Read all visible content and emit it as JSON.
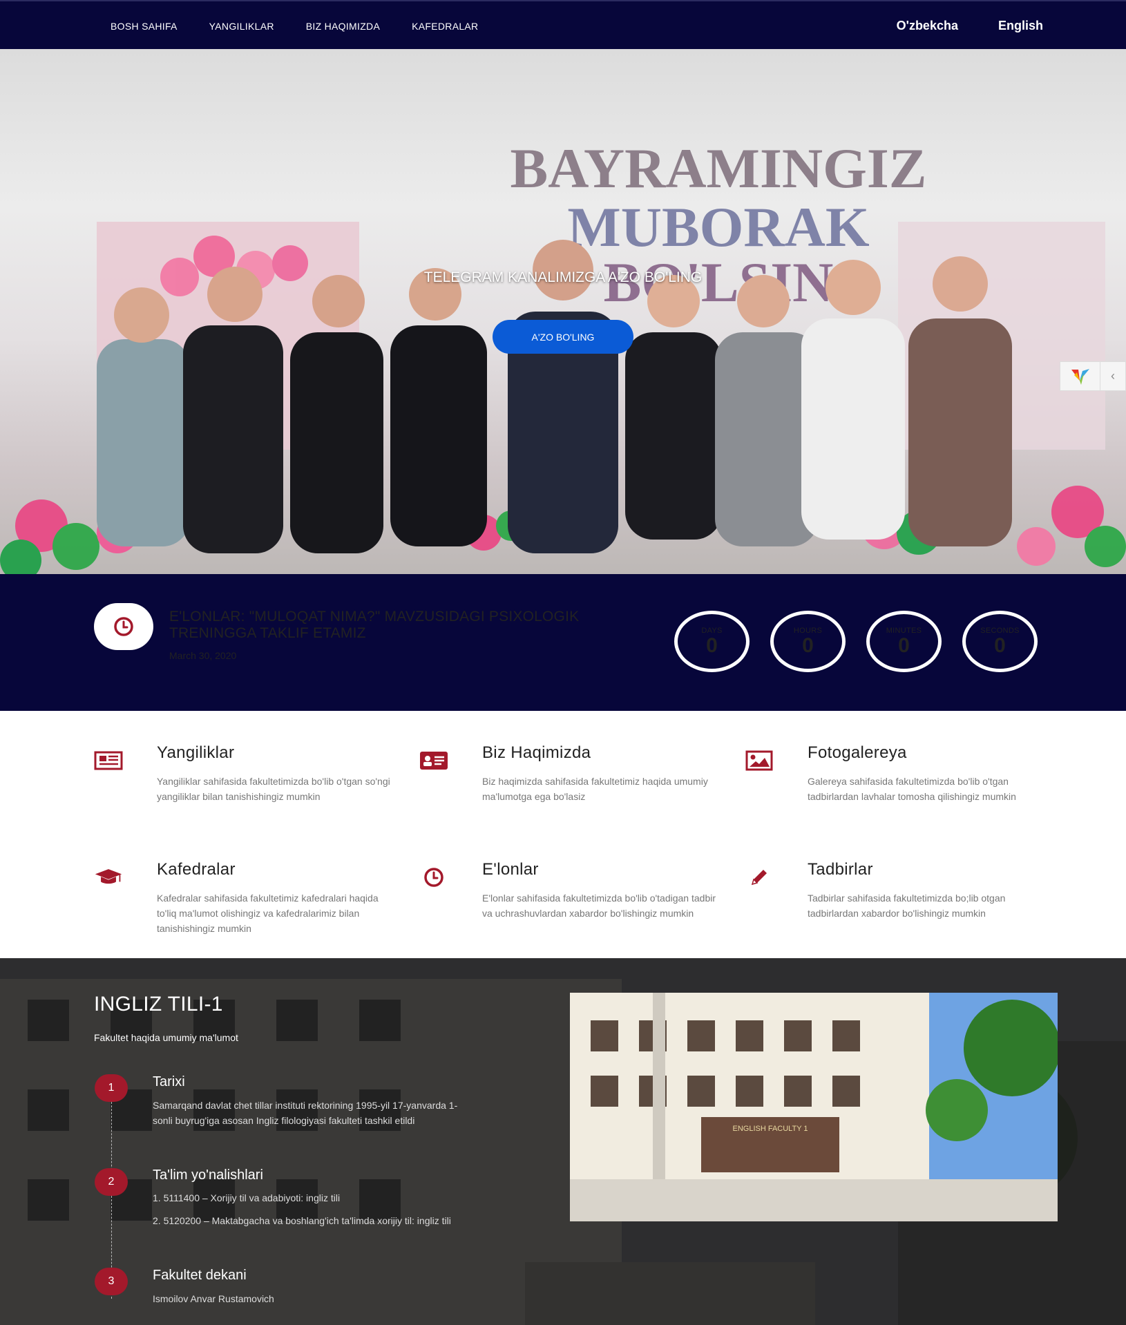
{
  "nav": {
    "links": [
      "BOSH SAHIFA",
      "YANGILIKLAR",
      "BIZ HAQIMIZDA",
      "KAFEDRALAR"
    ],
    "languages": [
      "O'zbekcha",
      "English"
    ]
  },
  "hero": {
    "banner_text_line1": "BAYRAMINGIZ",
    "banner_text_line2": "MUBORAK",
    "banner_text_line3": "BO'LSIN",
    "title": "TELEGRAM KANALIMIZGA A'ZO BO'LING",
    "button": "A'ZO BO'LING"
  },
  "announcement": {
    "title": "E'LONLAR: \"MULOQAT NIMA?\" MAVZUSIDAGI PSIXOLOGIK TRENINGGA TAKLIF ETAMIZ",
    "date": "March 30, 2020",
    "countdown": [
      {
        "label": "DAYS",
        "value": "0"
      },
      {
        "label": "HOURS",
        "value": "0"
      },
      {
        "label": "MINUTES",
        "value": "0"
      },
      {
        "label": "SECONDS",
        "value": "0"
      }
    ]
  },
  "features": [
    {
      "icon": "newspaper-icon",
      "title": "Yangiliklar",
      "desc": "Yangiliklar sahifasida fakultetimizda bo'lib o'tgan so'ngi yangiliklar bilan tanishishingiz mumkin"
    },
    {
      "icon": "id-card-icon",
      "title": "Biz Haqimizda",
      "desc": "Biz haqimizda sahifasida fakultetimiz haqida umumiy ma'lumotga ega bo'lasiz"
    },
    {
      "icon": "picture-icon",
      "title": "Fotogalereya",
      "desc": "Galereya sahifasida fakultetimizda bo'lib o'tgan tadbirlardan lavhalar tomosha qilishingiz mumkin"
    },
    {
      "icon": "graduation-cap-icon",
      "title": "Kafedralar",
      "desc": "Kafedralar sahifasida fakultetimiz kafedralari haqida to'liq ma'lumot olishingiz va kafedralarimiz bilan tanishishingiz mumkin"
    },
    {
      "icon": "clock-icon",
      "title": "E'lonlar",
      "desc": "E'lonlar sahifasida fakultetimizda bo'lib o'tadigan tadbir va uchrashuvlardan xabardor bo'lishingiz mumkin"
    },
    {
      "icon": "pencil-icon",
      "title": "Tadbirlar",
      "desc": "Tadbirlar sahifasida fakultetimizda bo;lib otgan tadbirlardan xabardor bo'lishingiz mumkin"
    }
  ],
  "about": {
    "title": "INGLIZ TILI-1",
    "subtitle": "Fakultet haqida umumiy ma'lumot",
    "timeline": [
      {
        "num": "1",
        "title": "Tarixi",
        "lines": [
          "Samarqand davlat chet tillar instituti rektorining 1995-yil 17-yanvarda 1-sonli buyrug'iga asosan Ingliz filologiyasi fakulteti tashkil etildi"
        ]
      },
      {
        "num": "2",
        "title": "Ta'lim yo'nalishlari",
        "lines": [
          "1. 5111400 – Xorijiy til va adabiyoti: ingliz tili",
          "2. 5120200 – Maktabgacha va boshlang'ich ta'limda xorijiy til: ingliz tili"
        ]
      },
      {
        "num": "3",
        "title": "Fakultet dekani",
        "lines": [
          "Ismoilov Anvar Rustamovich"
        ]
      }
    ],
    "building_sign": "ENGLISH FACULTY 1"
  },
  "colors": {
    "navy": "#07063a",
    "accent_red": "#a3192b",
    "button_blue": "#0b5bd6"
  }
}
